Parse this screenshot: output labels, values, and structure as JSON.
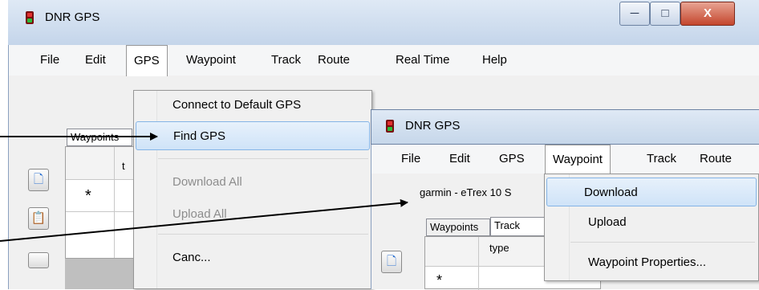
{
  "app_title": "DNR GPS",
  "window1": {
    "title": "DNR GPS",
    "menu": [
      "File",
      "Edit",
      "GPS",
      "Waypoint",
      "Track",
      "Route",
      "Real Time",
      "Help"
    ],
    "tab_partial": "Waypoints",
    "grid_header_partial": "t",
    "new_row_marker": "*",
    "gps_menu": {
      "items": [
        {
          "label": "Connect to Default GPS"
        },
        {
          "label": "Find GPS"
        },
        {
          "label": "Download All"
        },
        {
          "label": "Upload All"
        },
        {
          "label": "Canc..."
        }
      ]
    },
    "caption_glyphs": {
      "minimize": "─",
      "maximize": "□",
      "close": "X"
    }
  },
  "window2": {
    "title": "DNR GPS",
    "menu": [
      "File",
      "Edit",
      "GPS",
      "Waypoint",
      "Track",
      "Route"
    ],
    "device_partial": "garmin - eTrex 10 S",
    "tabs": [
      "Waypoints",
      "Track"
    ],
    "grid_header": "type",
    "new_row_marker": "*",
    "waypoint_menu": {
      "items": [
        {
          "label": "Download"
        },
        {
          "label": "Upload"
        },
        {
          "label": "Waypoint Properties..."
        }
      ]
    }
  },
  "colors": {
    "highlight": "#cfe3f8",
    "disabled_text": "#8d8d8d",
    "title_gradient": "#c4d5ea",
    "close_button": "#c4462d"
  },
  "icons": [
    "gps-app-icon",
    "copy-icon",
    "paste-icon",
    "arrow-pointer"
  ]
}
